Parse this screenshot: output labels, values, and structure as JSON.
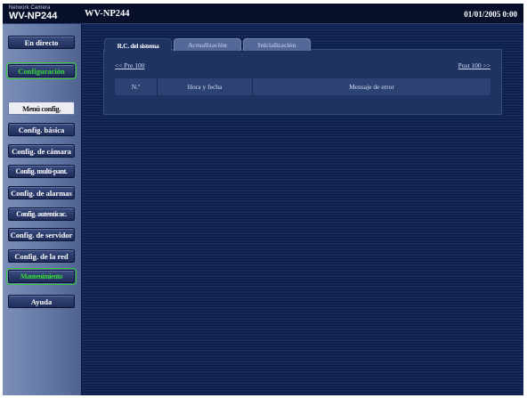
{
  "header": {
    "brand_small": "Network Camera",
    "brand_model": "WV-NP244",
    "page_model": "WV-NP244",
    "datetime": "01/01/2005  0:00"
  },
  "sidebar": {
    "live": "En directo",
    "config": "Configuración",
    "menu_label": "Menú config.",
    "items": [
      "Config. básica",
      "Config. de cámara",
      "Config. multi-pant.",
      "Config. de alarmas",
      "Config. autenticac.",
      "Config. de servidor",
      "Config. de la red",
      "Mantenimiento"
    ],
    "help": "Ayuda"
  },
  "tabs": [
    "R.C. del sistema",
    "Actualización",
    "Inicialización"
  ],
  "pager": {
    "prev": "<< Pre 100",
    "next": "Post 100 >>"
  },
  "table": {
    "columns": [
      "N.º",
      "Hora y fecha",
      "Mensaje de error"
    ]
  },
  "colors": {
    "active_green": "#36d93a",
    "background": "#0e1d44"
  }
}
